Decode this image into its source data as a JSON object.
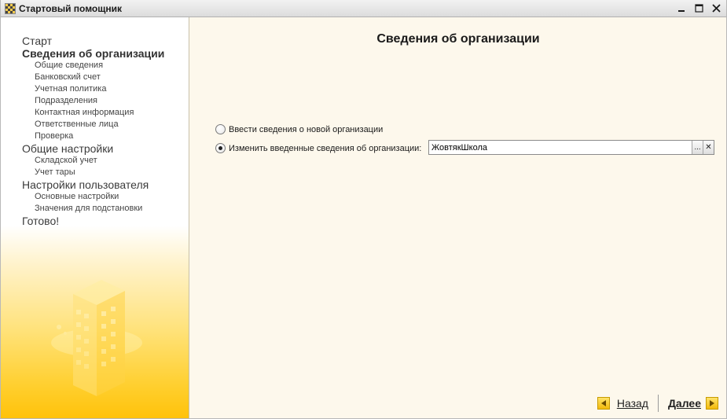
{
  "window": {
    "title": "Стартовый помощник"
  },
  "sidebar": {
    "items": [
      {
        "label": "Старт",
        "level": 1,
        "active": false
      },
      {
        "label": "Сведения об организации",
        "level": 1,
        "active": true
      },
      {
        "label": "Общие сведения",
        "level": 2
      },
      {
        "label": "Банковский счет",
        "level": 2
      },
      {
        "label": "Учетная политика",
        "level": 2
      },
      {
        "label": "Подразделения",
        "level": 2
      },
      {
        "label": "Контактная информация",
        "level": 2
      },
      {
        "label": "Ответственные лица",
        "level": 2
      },
      {
        "label": "Проверка",
        "level": 2
      },
      {
        "label": "Общие настройки",
        "level": 1,
        "active": false
      },
      {
        "label": "Складской учет",
        "level": 2
      },
      {
        "label": "Учет тары",
        "level": 2
      },
      {
        "label": "Настройки пользователя",
        "level": 1,
        "active": false
      },
      {
        "label": "Основные настройки",
        "level": 2
      },
      {
        "label": "Значения для подстановки",
        "level": 2
      },
      {
        "label": "Готово!",
        "level": 1,
        "active": false
      }
    ]
  },
  "main": {
    "title": "Сведения об организации",
    "option_new": "Ввести сведения о новой организации",
    "option_edit": "Изменить введенные сведения об организации:",
    "selected_option": "edit",
    "org_value": "ЖовтякШкола",
    "select_button": "...",
    "clear_button": "✕"
  },
  "footer": {
    "back_label": "Назад",
    "next_label": "Далее"
  },
  "colors": {
    "accent": "#ffc20a",
    "background": "#fdf8ec"
  },
  "icons": {
    "app": "app-icon",
    "minimize": "minimize-icon",
    "maximize": "maximize-icon",
    "close": "close-icon",
    "back": "arrow-left-icon",
    "next": "arrow-right-icon"
  }
}
